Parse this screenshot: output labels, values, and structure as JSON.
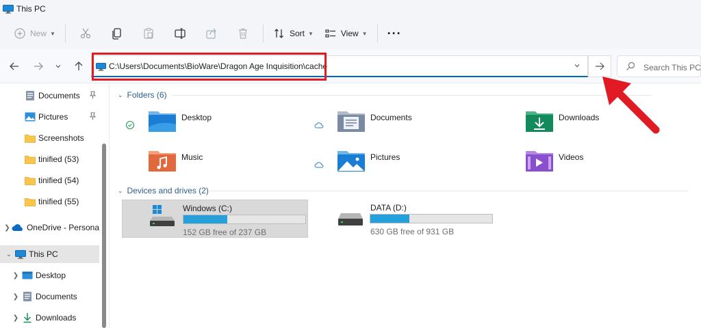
{
  "window": {
    "title": "This PC"
  },
  "toolbar": {
    "new_label": "New",
    "sort_label": "Sort",
    "view_label": "View",
    "more_label": "···"
  },
  "address": {
    "path": "C:\\Users\\Documents\\BioWare\\Dragon Age Inquisition\\cache",
    "search_placeholder": "Search This PC"
  },
  "sidebar": {
    "items": [
      {
        "label": "Documents",
        "icon": "documents-icon",
        "pinned": true
      },
      {
        "label": "Pictures",
        "icon": "pictures-icon",
        "pinned": true
      },
      {
        "label": "Screenshots",
        "icon": "folder-icon"
      },
      {
        "label": "tinified (53)",
        "icon": "folder-icon"
      },
      {
        "label": "tinified (54)",
        "icon": "folder-icon"
      },
      {
        "label": "tinified (55)",
        "icon": "folder-icon"
      },
      {
        "label": "OneDrive - Persona",
        "icon": "onedrive-icon"
      },
      {
        "label": "This PC",
        "icon": "this-pc-icon"
      },
      {
        "label": "Desktop",
        "icon": "desktop-icon"
      },
      {
        "label": "Documents",
        "icon": "documents-icon"
      },
      {
        "label": "Downloads",
        "icon": "downloads-icon"
      }
    ]
  },
  "main": {
    "folders_header": "Folders (6)",
    "folders": [
      {
        "name": "Desktop",
        "icon": "desktop-folder-icon",
        "status": "synced"
      },
      {
        "name": "Documents",
        "icon": "documents-folder-icon",
        "status": "cloud"
      },
      {
        "name": "Downloads",
        "icon": "downloads-folder-icon"
      },
      {
        "name": "Music",
        "icon": "music-folder-icon"
      },
      {
        "name": "Pictures",
        "icon": "pictures-folder-icon",
        "status": "cloud"
      },
      {
        "name": "Videos",
        "icon": "videos-folder-icon"
      }
    ],
    "drives_header": "Devices and drives (2)",
    "drives": [
      {
        "name": "Windows (C:)",
        "free": "152 GB free of 237 GB",
        "used_fraction": 0.36
      },
      {
        "name": "DATA (D:)",
        "free": "630 GB free of 931 GB",
        "used_fraction": 0.32
      }
    ]
  },
  "colors": {
    "accent": "#0067c0",
    "highlight": "#e01b24",
    "drive_bar": "#26a0da"
  }
}
